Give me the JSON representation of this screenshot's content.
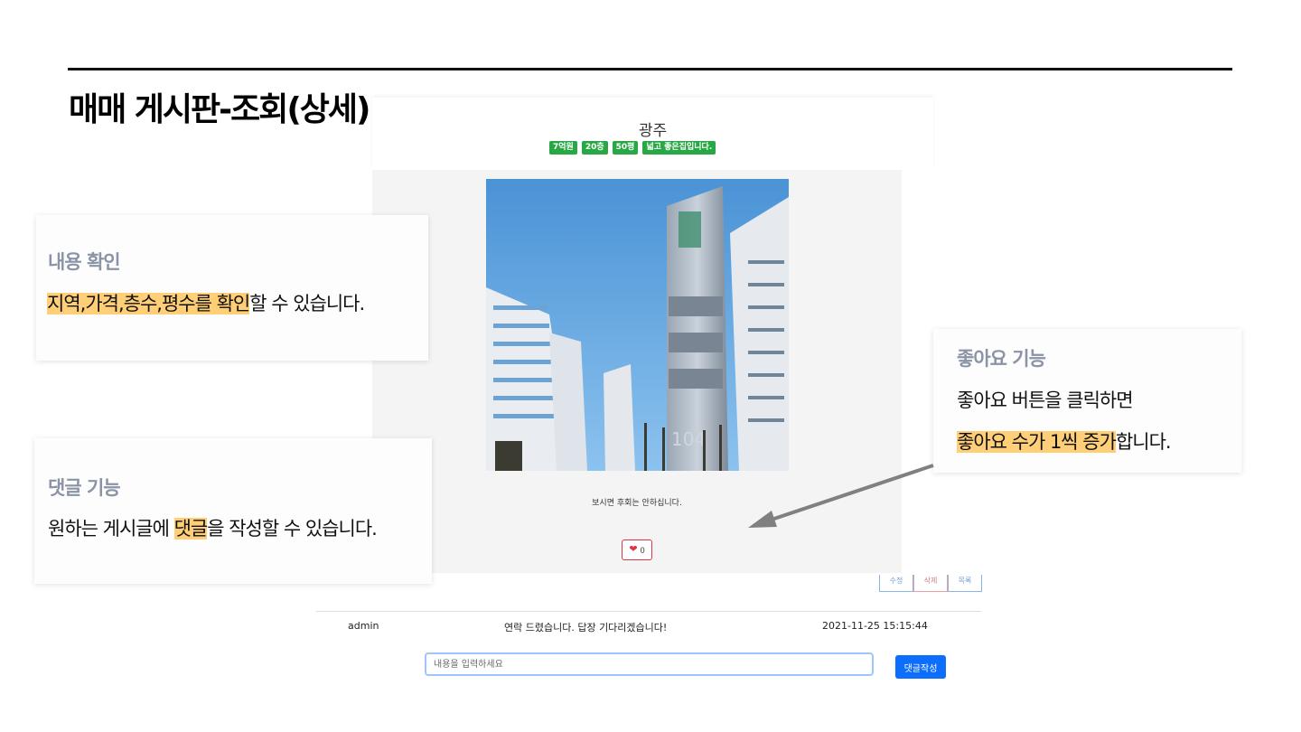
{
  "slide": {
    "title": "매매 게시판-조회(상세)"
  },
  "post": {
    "region": "광주",
    "tags": [
      "7억원",
      "20층",
      "50평",
      "넓고 좋은집입니다."
    ],
    "description": "보시면 후회는 안하십니다.",
    "likes": "0",
    "pager": [
      "수정",
      "삭제",
      "목록"
    ]
  },
  "comments": {
    "items": [
      {
        "author": "admin",
        "text": "연락 드렸습니다. 답장 기다리겠습니다!",
        "date": "2021-11-25 15:15:44"
      }
    ],
    "input_placeholder": "내용을 입력하세요",
    "submit_label": "댓글작성"
  },
  "callouts": {
    "content": {
      "title": "내용 확인",
      "highlight": "지역,가격,층수,평수를 확인",
      "rest": "할 수 있습니다."
    },
    "comment": {
      "title": "댓글 기능",
      "before": "원하는 게시글에 ",
      "highlight": "댓글",
      "rest": "을 작성할 수 있습니다."
    },
    "like": {
      "title": "좋아요 기능",
      "line1": "좋아요 버튼을 클릭하면",
      "highlight": "좋아요 수가 1씩 증가",
      "rest": "합니다."
    }
  },
  "colors": {
    "tag_green": "#28a745",
    "highlight": "#ffcf77",
    "primary": "#0d6efd",
    "like_red": "#dc3545",
    "callout_title": "#8a94a6"
  }
}
